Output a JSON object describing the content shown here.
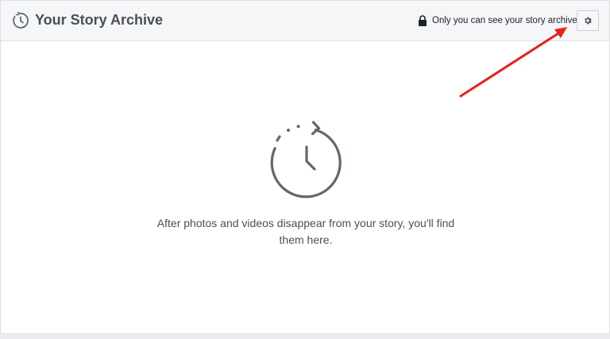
{
  "header": {
    "title": "Your Story Archive",
    "title_icon": "archive-clock-icon",
    "privacy_icon": "lock-icon",
    "privacy_text": "Only you can see your story archive",
    "settings_icon": "gear-icon"
  },
  "main": {
    "empty_state_icon": "archive-clock-icon",
    "empty_message": "After photos and videos disappear from your story, you'll find them here."
  },
  "annotation": {
    "type": "arrow",
    "color": "#e8201c",
    "points_to": "settings-button"
  },
  "colors": {
    "header_bg": "#f5f6f7",
    "panel_bg": "#ffffff",
    "page_bg": "#e9ebee",
    "text": "#4b4f56",
    "icon": "#606770"
  }
}
